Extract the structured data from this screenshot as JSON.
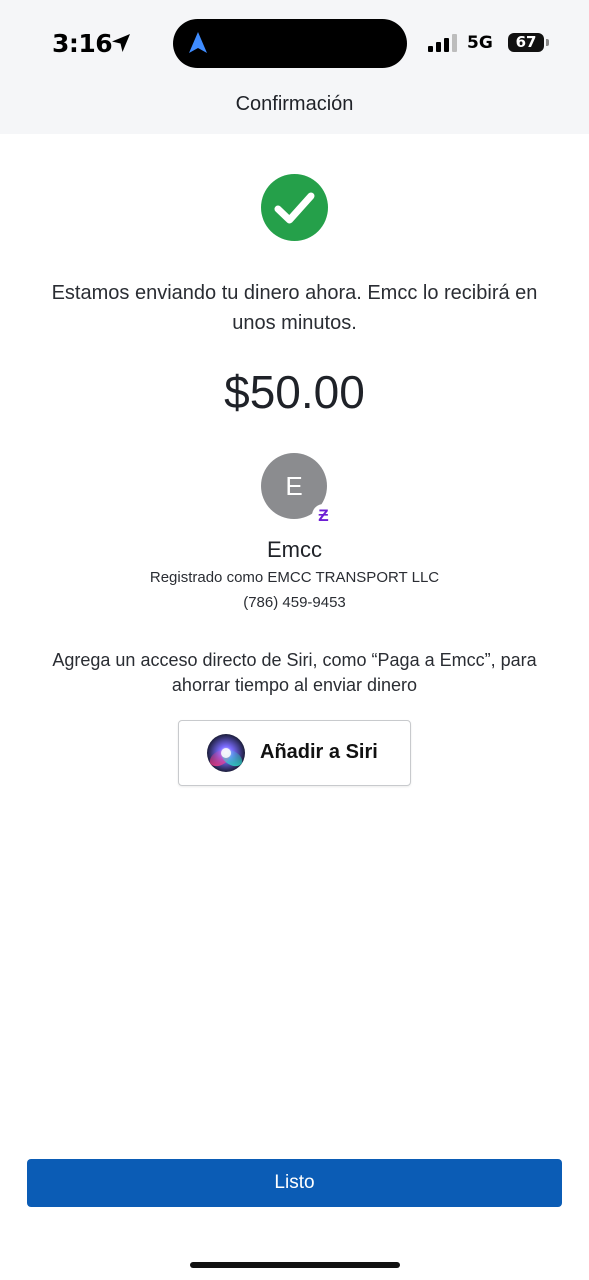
{
  "status_bar": {
    "time": "3:16",
    "network": "5G",
    "battery_level": "67",
    "icons": [
      "location-arrow-icon",
      "navigation-arrow-icon",
      "cellular-signal-icon",
      "battery-icon"
    ]
  },
  "header": {
    "title": "Confirmación"
  },
  "confirmation": {
    "status_icon": "check-circle-icon",
    "message": "Estamos enviando tu dinero ahora. Emcc lo recibirá en unos minutos.",
    "amount": "$50.00"
  },
  "recipient": {
    "initial": "E",
    "payment_network_icon": "zelle-icon",
    "payment_network_glyph": "Ƶ",
    "name": "Emcc",
    "registered_as": "Registrado como EMCC TRANSPORT LLC",
    "phone": "(786) 459-9453"
  },
  "siri": {
    "note": "Agrega un acceso directo de Siri, como “Paga a Emcc”, para ahorrar tiempo al enviar dinero",
    "button_label": "Añadir a Siri",
    "icon": "siri-icon"
  },
  "footer": {
    "done_label": "Listo"
  },
  "colors": {
    "success_green": "#25a04a",
    "primary_blue": "#0b5cb5",
    "zelle_purple": "#6d1ed4",
    "avatar_gray": "#8b8c8f",
    "header_background": "#f5f6f8"
  }
}
